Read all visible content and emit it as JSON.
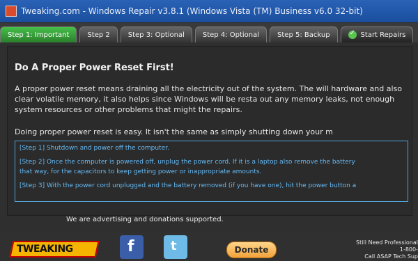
{
  "window": {
    "title": "Tweaking.com - Windows Repair v3.8.1 (Windows Vista (TM) Business v6.0 32-bit)"
  },
  "tabs": [
    {
      "label": "Step 1: Important"
    },
    {
      "label": "Step 2"
    },
    {
      "label": "Step 3: Optional"
    },
    {
      "label": "Step 4: Optional"
    },
    {
      "label": "Step 5: Backup"
    },
    {
      "label": "Start Repairs"
    }
  ],
  "main": {
    "heading": "Do A Proper Power Reset First!",
    "paragraph1": "A proper power reset means draining all the electricity out of the system. The will hardware and also clear volatile memory, it also helps since Windows will be resta out any memory leaks, not enough system resources or other problems that might the repairs.",
    "paragraph2": "Doing proper power reset is easy. It isn't the same as simply shutting down your m",
    "steps": [
      "[Step 1] Shutdown and power off the computer.",
      "[Step 2] Once the computer is powered off, unplug the power cord. If it is a laptop also remove the battery",
      "that way, for the capacitors to keep getting power or inappropriate amounts.",
      "[Step 3] With the power cord unplugged and the battery removed (if you have one), hit the power button a"
    ]
  },
  "footer": {
    "notice": "We are advertising and donations supported.",
    "logo_text": "TWEAKING",
    "fb_glyph": "f",
    "tw_glyph": "t",
    "donate_label": "Donate",
    "support_lines": [
      "Still Need Professional",
      "1-800-",
      "Call ASAP Tech Sup"
    ]
  },
  "colors": {
    "active_tab": "#2b7d2b",
    "titlebar": "#1b4f9e",
    "link_text": "#65b9f4"
  }
}
